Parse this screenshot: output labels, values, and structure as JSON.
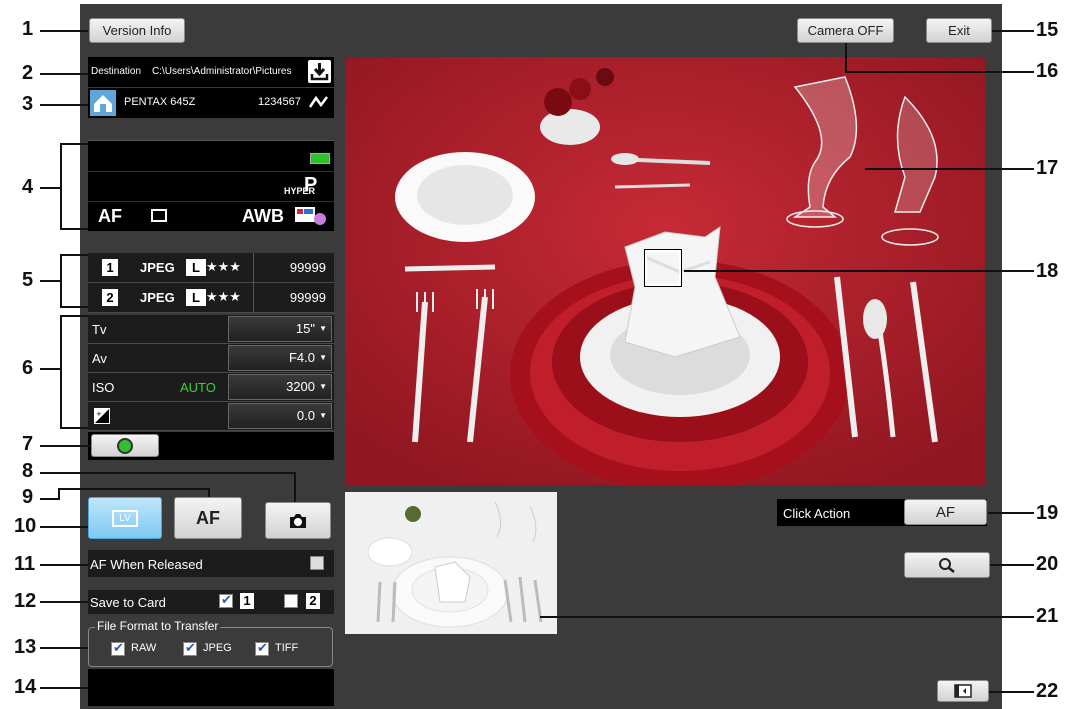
{
  "labels": {
    "n1": "1",
    "n2": "2",
    "n3": "3",
    "n4": "4",
    "n5": "5",
    "n6": "6",
    "n7": "7",
    "n8": "8",
    "n9": "9",
    "n10": "10",
    "n11": "11",
    "n12": "12",
    "n13": "13",
    "n14": "14",
    "n15": "15",
    "n16": "16",
    "n17": "17",
    "n18": "18",
    "n19": "19",
    "n20": "20",
    "n21": "21",
    "n22": "22"
  },
  "header": {
    "version_info": "Version Info",
    "camera_off": "Camera OFF",
    "exit": "Exit"
  },
  "destination": {
    "label": "Destination",
    "path": "C:\\Users\\Administrator\\Pictures"
  },
  "camera": {
    "model": "PENTAX 645Z",
    "serial": "1234567"
  },
  "status": {
    "hyper": "HYPER",
    "mode": "P",
    "af": "AF",
    "wb": "AWB"
  },
  "slots": [
    {
      "num": "1",
      "format": "JPEG",
      "size": "L",
      "quality": "★★★",
      "count": "99999"
    },
    {
      "num": "2",
      "format": "JPEG",
      "size": "L",
      "quality": "★★★",
      "count": "99999"
    }
  ],
  "exposure": {
    "tv_label": "Tv",
    "tv_value": "15\"",
    "av_label": "Av",
    "av_value": "F4.0",
    "iso_label": "ISO",
    "iso_auto": "AUTO",
    "iso_value": "3200",
    "ev_value": "0.0"
  },
  "controls": {
    "lv": "LV",
    "af": "AF"
  },
  "af_when_released": "AF When Released",
  "save_to_card": {
    "label": "Save to Card",
    "card1": "1",
    "card2": "2"
  },
  "file_format": {
    "legend": "File Format to Transfer",
    "raw": "RAW",
    "jpeg": "JPEG",
    "tiff": "TIFF"
  },
  "click_action": {
    "label": "Click Action",
    "value": "AF"
  },
  "colors": {
    "accent_green": "#2fbf2f",
    "auto_green": "#3bd13b",
    "tablecloth": "#b8202c"
  }
}
